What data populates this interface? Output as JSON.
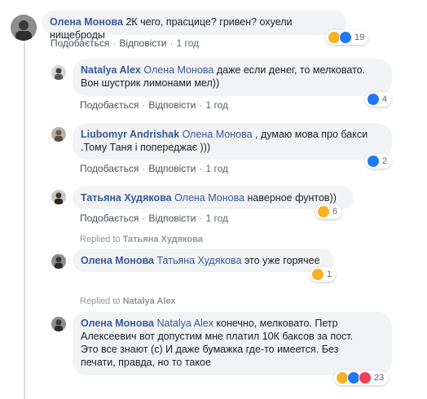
{
  "comments": [
    {
      "author": "Олена Монова",
      "text": "2К чего, прасцице? гривен? охуели нищеброды",
      "like": "Подобається",
      "reply": "Відповісти",
      "time": "1 год",
      "reaction_count": "19",
      "reactions": [
        "haha-icon",
        "like-icon"
      ]
    },
    {
      "author": "Natalya Alex",
      "mention": "Олена Монова",
      "text_line1": "даже если денег, то мелковато.",
      "text_line2": "Вон шустрик лимонами мел))",
      "like": "Подобається",
      "reply": "Відповісти",
      "time": "1 год",
      "reaction_count": "4",
      "reactions": [
        "like-icon"
      ]
    },
    {
      "author": "Liubomyr Andrishak",
      "mention": "Олена Монова",
      "text_line1": ", думаю мова про бакси",
      "text_line2": ".Тому Таня і попереджає )))",
      "like": "Подобається",
      "reply": "Відповісти",
      "time": "1 год",
      "reaction_count": "2",
      "reactions": [
        "like-icon"
      ]
    },
    {
      "author": "Татьяна Худякова",
      "mention": "Олена Монова",
      "text": "наверное фунтов))",
      "like": "Подобається",
      "reply": "Відповісти",
      "time": "1 год",
      "reaction_count": "6",
      "reactions": [
        "haha-icon"
      ]
    },
    {
      "replied_prefix": "Replied to",
      "replied_to": "Татьяна Худякова",
      "author": "Олена Монова",
      "mention": "Татьяна Худякова",
      "text": "это уже горячее",
      "reaction_count": "1",
      "reactions": [
        "haha-icon"
      ]
    },
    {
      "replied_prefix": "Replied to",
      "replied_to": "Natalya Alex",
      "author": "Олена Монова",
      "mention": "Natalya Alex",
      "text_line1": "конечно, мелковато. Петр",
      "text_line2": "Алексеевич вот допустим мне платил 10К баксов за пост.",
      "text_line3": "Это все знают (с) И даже бумажка где-то имеется. Без",
      "text_line4": "печати, правда, но то такое",
      "reaction_count": "23",
      "reactions": [
        "haha-icon",
        "like-icon",
        "love-icon"
      ]
    }
  ],
  "colors": {
    "link": "#385898",
    "bubble": "#f2f3f5",
    "meta": "#606770",
    "like": "#2078f4",
    "haha": "#f7b125",
    "love": "#f33e58"
  }
}
